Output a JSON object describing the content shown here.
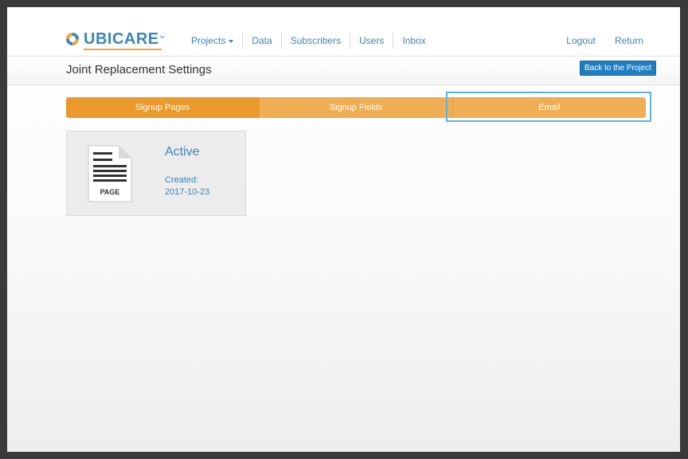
{
  "brand": {
    "name": "UBICARE",
    "trademark": "™",
    "colors": {
      "blue": "#3a86b8",
      "orange": "#f0a23d"
    }
  },
  "nav": {
    "items": [
      {
        "label": "Projects",
        "has_caret": true
      },
      {
        "label": "Data"
      },
      {
        "label": "Subscribers"
      },
      {
        "label": "Users"
      },
      {
        "label": "Inbox"
      }
    ],
    "right": {
      "logout": "Logout",
      "return": "Return"
    }
  },
  "page": {
    "title": "Joint Replacement Settings",
    "back_button": "Back to the Project"
  },
  "tabs": [
    {
      "label": "Signup Pages",
      "active": true
    },
    {
      "label": "Signup Fields",
      "active": false
    },
    {
      "label": "Email",
      "active": false,
      "highlighted": true
    }
  ],
  "card": {
    "icon": "page-document-icon",
    "icon_caption": "PAGE",
    "status": "Active",
    "created_label": "Created:",
    "created_date": "2017-10-23"
  },
  "colors": {
    "tab_active": "#ea9a2c",
    "tab": "#f0ae54",
    "button": "#1f7dc1",
    "highlight": "#5bb4e3"
  }
}
